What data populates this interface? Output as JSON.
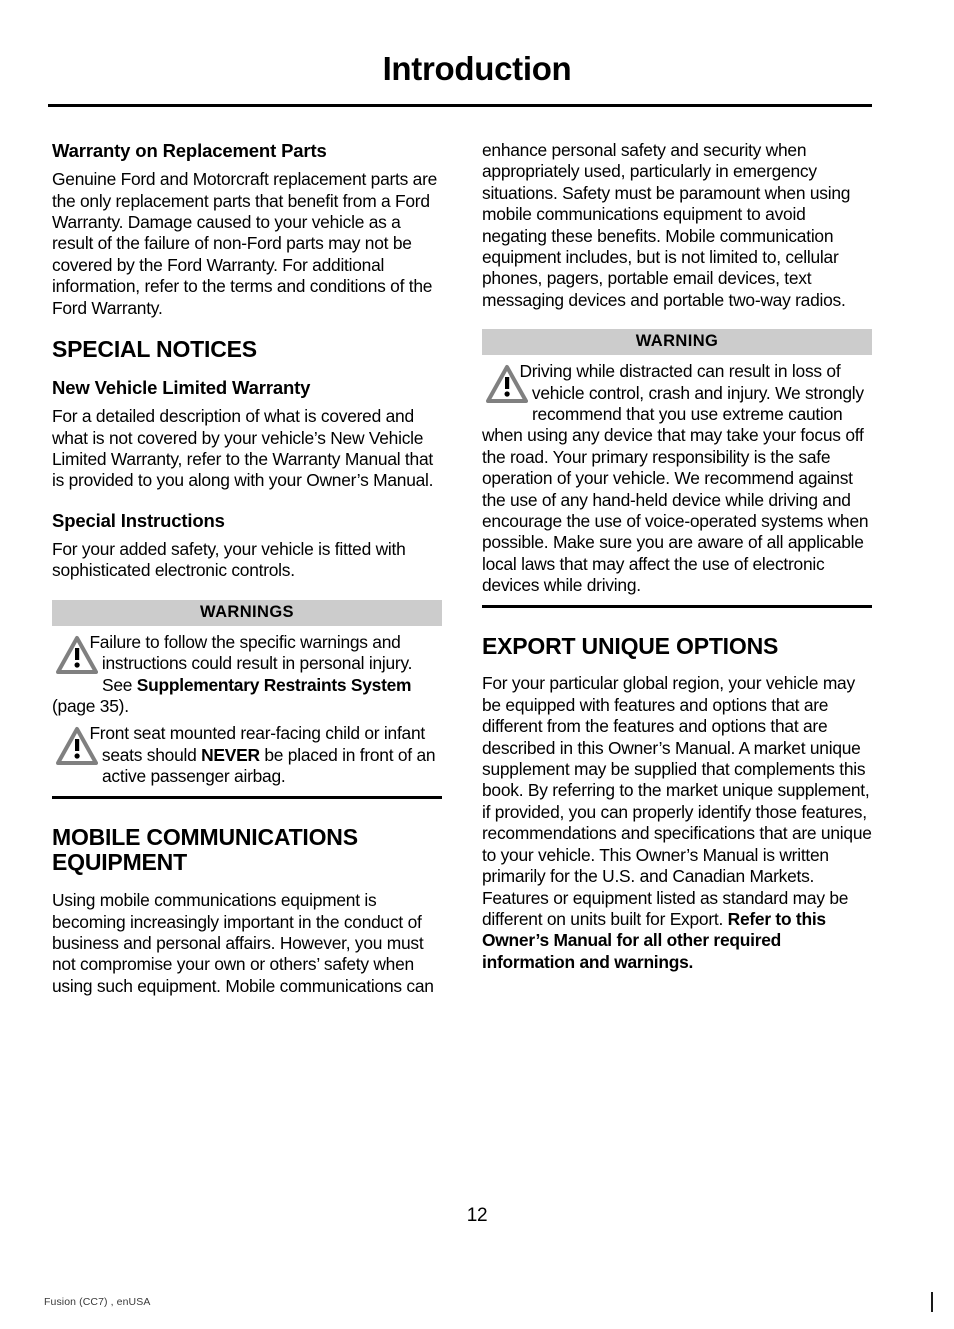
{
  "header": {
    "title": "Introduction"
  },
  "left_column": {
    "warranty_heading": "Warranty on Replacement Parts",
    "warranty_body": "Genuine Ford and Motorcraft replacement parts are the only replacement parts that benefit from a Ford Warranty. Damage caused to your vehicle as a result of the failure of non-Ford parts may not be covered by the Ford Warranty. For additional information, refer to the terms and conditions of the Ford Warranty.",
    "special_notices_heading": "SPECIAL NOTICES",
    "new_vehicle_warranty_heading": "New Vehicle Limited Warranty",
    "new_vehicle_warranty_body": "For a detailed description of what is covered and what is not covered by your vehicle’s New Vehicle Limited Warranty, refer to the Warranty Manual that is provided to you along with your Owner’s Manual.",
    "special_instructions_heading": "Special Instructions",
    "special_instructions_body": "For your added safety, your vehicle is fitted with sophisticated electronic controls.",
    "warnings_box": {
      "header": "WARNINGS",
      "items": [
        {
          "icon": "warning-triangle-icon",
          "text_before": "Failure to follow the specific warnings and instructions could result in personal injury.  See ",
          "bold_text": "Supplementary Restraints System",
          "text_after": " (page 35)."
        },
        {
          "icon": "warning-triangle-icon",
          "text_before": "Front seat mounted rear-facing child or infant seats should ",
          "bold_text": "NEVER",
          "text_after": " be placed in front of an active passenger airbag."
        }
      ]
    },
    "mobile_comm_heading": "MOBILE COMMUNICATIONS EQUIPMENT",
    "mobile_comm_body": "Using mobile communications equipment is becoming increasingly important in the conduct of business and personal affairs. However, you must not compromise your own or others’ safety when using such equipment. Mobile communications can"
  },
  "right_column": {
    "mobile_comm_continued": "enhance personal safety and security when appropriately used, particularly in emergency situations. Safety must be paramount when using mobile communications equipment to avoid negating these benefits. Mobile communication equipment includes, but is not limited to, cellular phones, pagers, portable email devices, text messaging devices and portable two-way radios.",
    "warning_box": {
      "header": "WARNING",
      "items": [
        {
          "icon": "warning-triangle-icon",
          "text_before": "Driving while distracted can result in loss of vehicle control, crash and injury. We strongly recommend that you use extreme caution when using any device that may take your focus off the road. Your primary responsibility is the safe operation of your vehicle. We recommend against the use of any hand-held device while driving and encourage the use of voice-operated systems when possible. Make sure you are aware of all applicable local laws that may affect the use of electronic devices while driving.",
          "bold_text": "",
          "text_after": ""
        }
      ]
    },
    "export_heading": "EXPORT UNIQUE OPTIONS",
    "export_body_plain": "For your particular global region, your vehicle may be equipped with features and options that are different from the features and options that are described in this Owner’s Manual. A market unique supplement may be supplied that complements this book. By referring to the market unique supplement, if provided, you can properly identify those features, recommendations and specifications that are unique to your vehicle. This Owner’s Manual is written primarily for the U.S. and Canadian Markets. Features or equipment listed as standard may be different on units built for Export. ",
    "export_body_bold": "Refer to this Owner’s Manual for all other required information and warnings."
  },
  "footer": {
    "page_number": "12",
    "note": "Fusion (CC7) , enUSA"
  },
  "colors": {
    "warning_header_bg": "#cccccc",
    "rule": "#000000",
    "triangle_stroke": "#808080",
    "text": "#000000"
  }
}
